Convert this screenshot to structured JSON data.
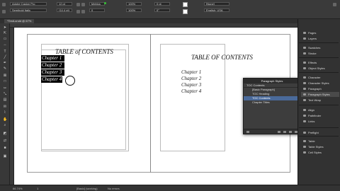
{
  "control_bar": {
    "font_family": "Adobe Caslon Pro",
    "font_style": "Semibold Italic",
    "font_size": "12 pt",
    "leading": "(14.4 pt)",
    "kerning": "Metrics",
    "tracking": "0",
    "h_scale": "100%",
    "v_scale": "100%",
    "baseline": "0 pt",
    "skew": "0°",
    "char_style": "[None]",
    "language": "English: USA"
  },
  "document": {
    "tab_label": "*TestLondd @ 67%"
  },
  "page_left": {
    "title": "TABLE of CONTENTS",
    "chapters": [
      "Chapter 1",
      "Chapter 2",
      "Chapter 3",
      "Chapter 4"
    ]
  },
  "page_right": {
    "title": "TABLE OF CONTENTS",
    "chapters": [
      "Chapter 1",
      "Chapter 2",
      "Chapter 3",
      "Chapter 4"
    ]
  },
  "paragraph_panel": {
    "title": "Paragraph Styles",
    "current": "TOC Contents",
    "items": [
      "[Basic Paragraph]",
      "TOC Heading",
      "TOC Contents",
      "Chapter Titles"
    ],
    "active_index": 2
  },
  "dock": {
    "items": [
      {
        "label": "Pages",
        "icon": "pages-icon"
      },
      {
        "label": "Layers",
        "icon": "layers-icon"
      },
      {
        "label": "Swatches",
        "icon": "swatches-icon"
      },
      {
        "label": "Stroke",
        "icon": "stroke-icon"
      },
      {
        "label": "Effects",
        "icon": "effects-icon"
      },
      {
        "label": "Object Styles",
        "icon": "object-styles-icon"
      },
      {
        "label": "Character",
        "icon": "character-icon"
      },
      {
        "label": "Character Styles",
        "icon": "character-styles-icon"
      },
      {
        "label": "Paragraph",
        "icon": "paragraph-icon"
      },
      {
        "label": "Paragraph Styles",
        "icon": "paragraph-styles-icon"
      },
      {
        "label": "Text Wrap",
        "icon": "text-wrap-icon"
      },
      {
        "label": "Align",
        "icon": "align-icon"
      },
      {
        "label": "Pathfinder",
        "icon": "pathfinder-icon"
      },
      {
        "label": "Links",
        "icon": "links-icon"
      },
      {
        "label": "Preflight",
        "icon": "preflight-icon"
      },
      {
        "label": "Table",
        "icon": "table-icon"
      },
      {
        "label": "Table Styles",
        "icon": "table-styles-icon"
      },
      {
        "label": "Cell Styles",
        "icon": "cell-styles-icon"
      }
    ],
    "active_index": 9
  },
  "status_bar": {
    "zoom": "66.74%",
    "page": "1",
    "profile": "[Basic] (working)",
    "preflight": "No errors"
  },
  "colors": {
    "accent": "#4a6a9a",
    "preflight_ok": "#35c335",
    "selection": "#000000"
  }
}
